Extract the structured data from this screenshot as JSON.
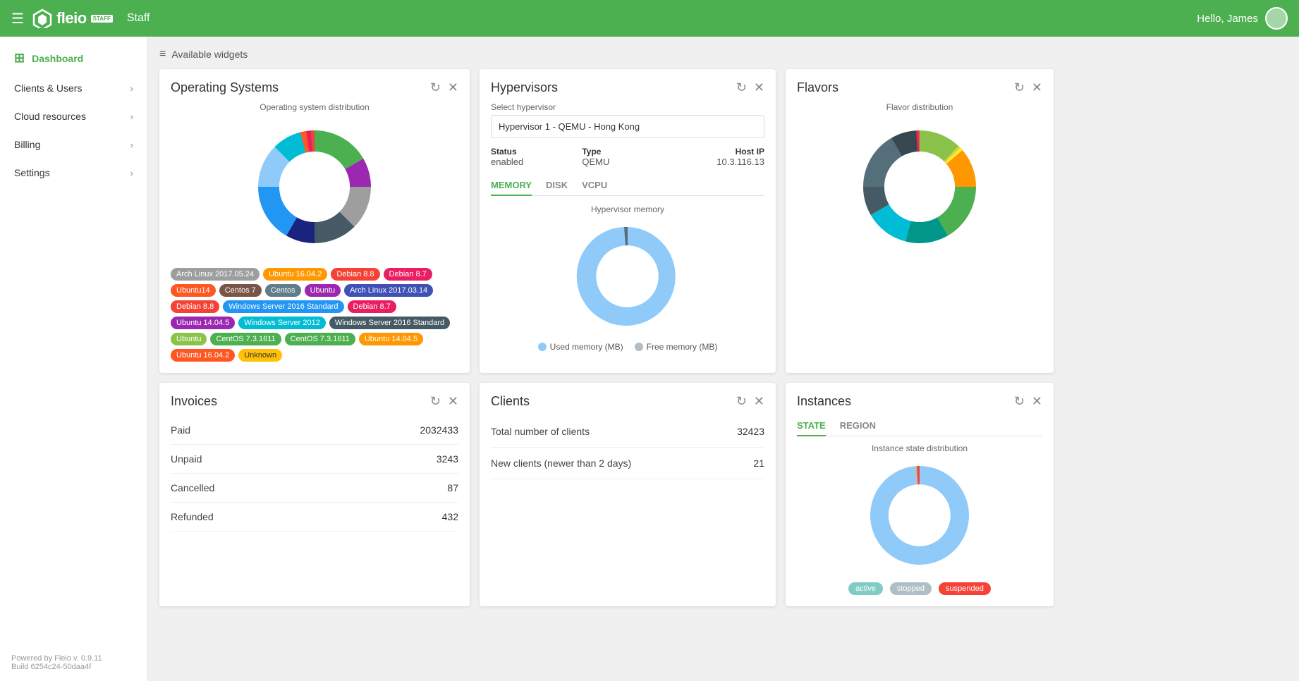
{
  "topnav": {
    "hamburger": "☰",
    "logo_text": "fleio",
    "logo_badge": "STAFF",
    "staff_label": "Staff",
    "hello": "Hello, James"
  },
  "sidebar": {
    "items": [
      {
        "label": "Dashboard",
        "active": true,
        "icon": "grid"
      },
      {
        "label": "Clients & Users",
        "chevron": true
      },
      {
        "label": "Cloud resources",
        "chevron": true
      },
      {
        "label": "Billing",
        "chevron": true
      },
      {
        "label": "Settings",
        "chevron": true
      }
    ],
    "footer_line1": "Powered by Fleio v. 0.9.11",
    "footer_line2": "Build 6254c24-50daa4f"
  },
  "available_widgets": "Available widgets",
  "os_widget": {
    "title": "Operating Systems",
    "chart_title": "Operating system distribution",
    "tags": [
      {
        "label": "Arch Linux 2017.05.24",
        "color": "#9e9e9e"
      },
      {
        "label": "Ubuntu 16.04.2",
        "color": "#ff9800"
      },
      {
        "label": "Debian 8.8",
        "color": "#f44336"
      },
      {
        "label": "Debian 8.7",
        "color": "#e91e63"
      },
      {
        "label": "Ubuntu14",
        "color": "#ff5722"
      },
      {
        "label": "Centos 7",
        "color": "#795548"
      },
      {
        "label": "Centos",
        "color": "#607d8b"
      },
      {
        "label": "Ubuntu",
        "color": "#9c27b0"
      },
      {
        "label": "Arch Linux 2017.03.14",
        "color": "#3f51b5"
      },
      {
        "label": "Debian 8.8",
        "color": "#f44336"
      },
      {
        "label": "Windows Server 2016 Standard",
        "color": "#2196f3"
      },
      {
        "label": "Debian 8.7",
        "color": "#e91e63"
      },
      {
        "label": "Ubuntu 14.04.5",
        "color": "#9c27b0"
      },
      {
        "label": "Windows Server 2012",
        "color": "#00bcd4"
      },
      {
        "label": "Windows Server 2016 Standard",
        "color": "#455a64"
      },
      {
        "label": "Ubuntu",
        "color": "#8bc34a"
      },
      {
        "label": "CentOS 7.3.1611",
        "color": "#4caf50"
      },
      {
        "label": "CentOS 7.3.1611",
        "color": "#4caf50"
      },
      {
        "label": "Ubuntu 14.04.5",
        "color": "#ff9800"
      },
      {
        "label": "Ubuntu 16.04.2",
        "color": "#ff5722"
      },
      {
        "label": "Unknown",
        "color": "#ffc107"
      }
    ]
  },
  "hypervisors_widget": {
    "title": "Hypervisors",
    "select_label": "Select hypervisor",
    "selected": "Hypervisor 1 - QEMU - Hong Kong",
    "status_label": "Status",
    "type_label": "Type",
    "host_ip_label": "Host IP",
    "status_value": "enabled",
    "type_value": "QEMU",
    "host_ip_value": "10.3.116.13",
    "tabs": [
      "MEMORY",
      "DISK",
      "VCPU"
    ],
    "active_tab": "MEMORY",
    "memory_chart_label": "Hypervisor memory",
    "legend_used": "Used memory (MB)",
    "legend_free": "Free memory (MB)"
  },
  "invoices_widget": {
    "title": "Invoices",
    "rows": [
      {
        "label": "Paid",
        "value": "2032433"
      },
      {
        "label": "Unpaid",
        "value": "3243"
      },
      {
        "label": "Cancelled",
        "value": "87"
      },
      {
        "label": "Refunded",
        "value": "432"
      }
    ]
  },
  "clients_widget": {
    "title": "Clients",
    "rows": [
      {
        "label": "Total number of clients",
        "value": "32423"
      },
      {
        "label": "New clients (newer than 2 days)",
        "value": "21"
      }
    ]
  },
  "flavors_widget": {
    "title": "Flavors",
    "chart_title": "Flavor distribution"
  },
  "instances_widget": {
    "title": "Instances",
    "tabs": [
      "STATE",
      "REGION"
    ],
    "active_tab": "STATE",
    "chart_label": "Instance state distribution",
    "legend": [
      {
        "label": "active",
        "color": "#80cbc4"
      },
      {
        "label": "stopped",
        "color": "#b0bec5"
      },
      {
        "label": "suspended",
        "color": "#f44336"
      }
    ]
  }
}
